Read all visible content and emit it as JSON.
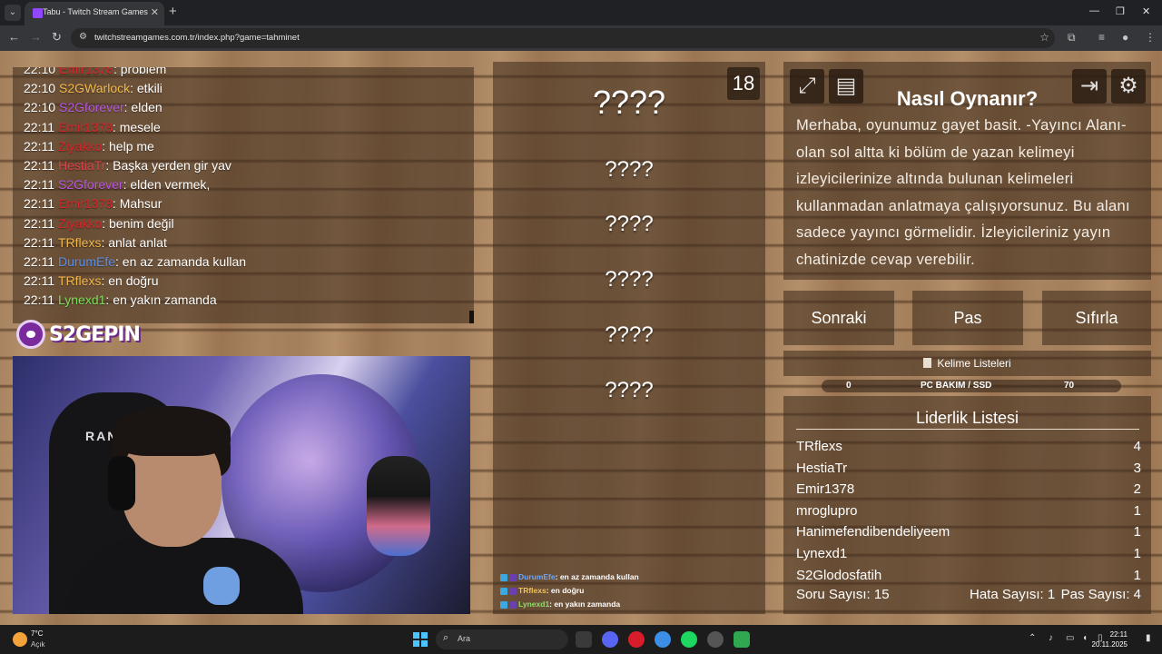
{
  "browser": {
    "tab_title": "Tabu - Twitch Stream Games",
    "url": "twitchstreamgames.com.tr/index.php?game=tahminet"
  },
  "chat": [
    {
      "time": "22:10",
      "user": "Emir1378",
      "color": "#d8252c",
      "message": ": problem"
    },
    {
      "time": "22:10",
      "user": "S2GWarlock",
      "color": "#f1b84a",
      "message": ": etkili"
    },
    {
      "time": "22:10",
      "user": "S2Gforever",
      "color": "#b557e0",
      "message": ": elden"
    },
    {
      "time": "22:11",
      "user": "Emir1378",
      "color": "#d8252c",
      "message": ": mesele"
    },
    {
      "time": "22:11",
      "user": "Ziyakko",
      "color": "#d8252c",
      "message": ": help me"
    },
    {
      "time": "22:11",
      "user": "HestiaTr",
      "color": "#e0404a",
      "message": ": Başka yerden gir yav"
    },
    {
      "time": "22:11",
      "user": "S2Gforever",
      "color": "#b557e0",
      "message": ": elden vermek,"
    },
    {
      "time": "22:11",
      "user": "Emir1378",
      "color": "#d8252c",
      "message": ": Mahsur"
    },
    {
      "time": "22:11",
      "user": "Ziyakko",
      "color": "#d8252c",
      "message": ": benim değil"
    },
    {
      "time": "22:11",
      "user": "TRflexs",
      "color": "#f1b84a",
      "message": ": anlat anlat"
    },
    {
      "time": "22:11",
      "user": "DurumEfe",
      "color": "#5a8fe6",
      "message": ": en az zamanda kullan"
    },
    {
      "time": "22:11",
      "user": "TRflexs",
      "color": "#f1b84a",
      "message": ": en doğru"
    },
    {
      "time": "22:11",
      "user": "Lynexd1",
      "color": "#7be05a",
      "message": ": en yakın zamanda"
    }
  ],
  "logo_text": "S2GEPIN",
  "webcam": {
    "chair_brand": "RANCER"
  },
  "game": {
    "counter": "18",
    "main_word": "????",
    "forbidden_words": [
      "????",
      "????",
      "????",
      "????",
      "????"
    ]
  },
  "mini_chat": [
    {
      "user": "DurumEfe",
      "color": "#6aa6ff",
      "message": ": en az zamanda kullan"
    },
    {
      "user": "TRflexs",
      "color": "#f1c25a",
      "message": ": en doğru"
    },
    {
      "user": "Lynexd1",
      "color": "#8be06a",
      "message": ": en yakın zamanda"
    }
  ],
  "howto": {
    "title": "Nasıl Oynanır?",
    "text": "Merhaba, oyunumuz gayet basit. -Yayıncı Alanı- olan sol altta ki bölüm de yazan kelimeyi izleyicilerinize altında bulunan kelimeleri kullanmadan anlatmaya çalışıyorsunuz. Bu alanı sadece yayıncı görmelidir. İzleyicileriniz yayın chatinizde cevap verebilir."
  },
  "actions": {
    "next": "Sonraki",
    "pass": "Pas",
    "reset": "Sıfırla"
  },
  "wordlist": {
    "label": "Kelime Listeleri",
    "left_count": "0",
    "name": "PC BAKIM / SSD",
    "right_count": "70"
  },
  "leaderboard": {
    "title": "Liderlik Listesi",
    "rows": [
      {
        "name": "TRflexs",
        "score": "4"
      },
      {
        "name": "HestiaTr",
        "score": "3"
      },
      {
        "name": "Emir1378",
        "score": "2"
      },
      {
        "name": "mroglupro",
        "score": "1"
      },
      {
        "name": "Hanimefendibendeliyeem",
        "score": "1"
      },
      {
        "name": "Lynexd1",
        "score": "1"
      },
      {
        "name": "S2Glodosfatih",
        "score": "1"
      }
    ],
    "question_count": "Soru Sayısı: 15",
    "error_count": "Hata Sayısı: 1",
    "pass_count": "Pas Sayısı: 4"
  },
  "taskbar": {
    "temperature": "7°C",
    "weather": "Açık",
    "search_placeholder": "Ara",
    "time": "22:11",
    "date": "20.11.2025"
  }
}
